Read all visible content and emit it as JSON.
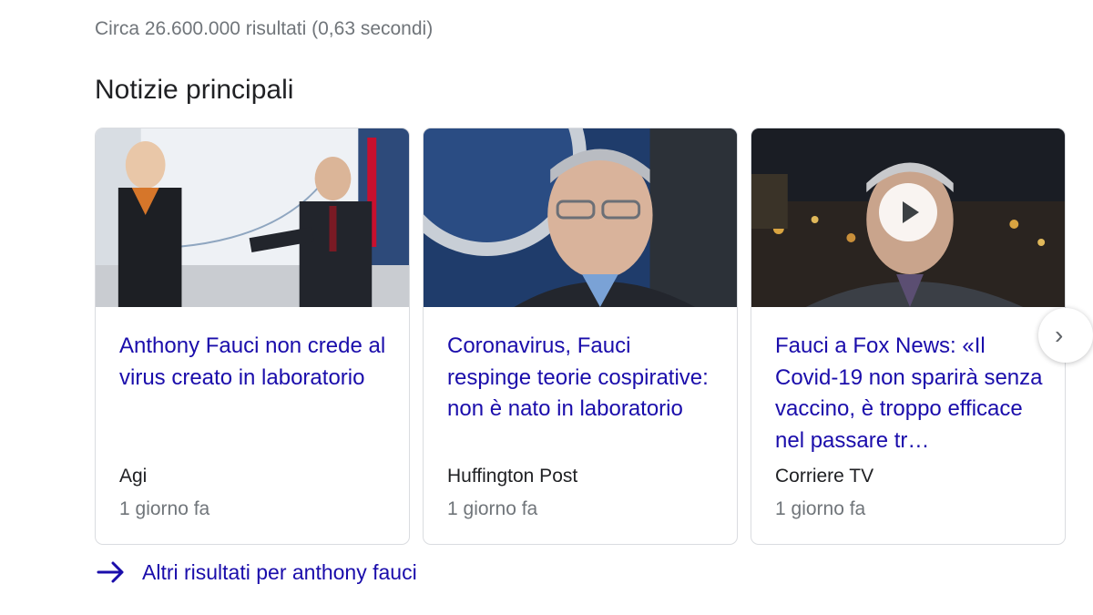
{
  "result_stats": "Circa 26.600.000 risultati (0,63 secondi)",
  "section_title": "Notizie principali",
  "cards": [
    {
      "headline": "Anthony Fauci non crede al virus creato in laboratorio",
      "source": "Agi",
      "age": "1 giorno fa",
      "has_video": false
    },
    {
      "headline": "Coronavirus, Fauci respinge teorie cospirative: non è nato in laboratorio",
      "source": "Huffington Post",
      "age": "1 giorno fa",
      "has_video": false
    },
    {
      "headline": "Fauci a Fox News: «Il Covid-19 non sparirà senza vaccino, è troppo efficace nel passare tr…",
      "source": "Corriere TV",
      "age": "1 giorno fa",
      "has_video": true
    }
  ],
  "next_button_icon": "chevron-right-icon",
  "more_link": {
    "label": "Altri risultati per anthony fauci",
    "icon": "arrow-right-icon"
  },
  "colors": {
    "link": "#1a0dab",
    "secondary_text": "#70757a",
    "primary_text": "#202124",
    "border": "#dadce0"
  }
}
